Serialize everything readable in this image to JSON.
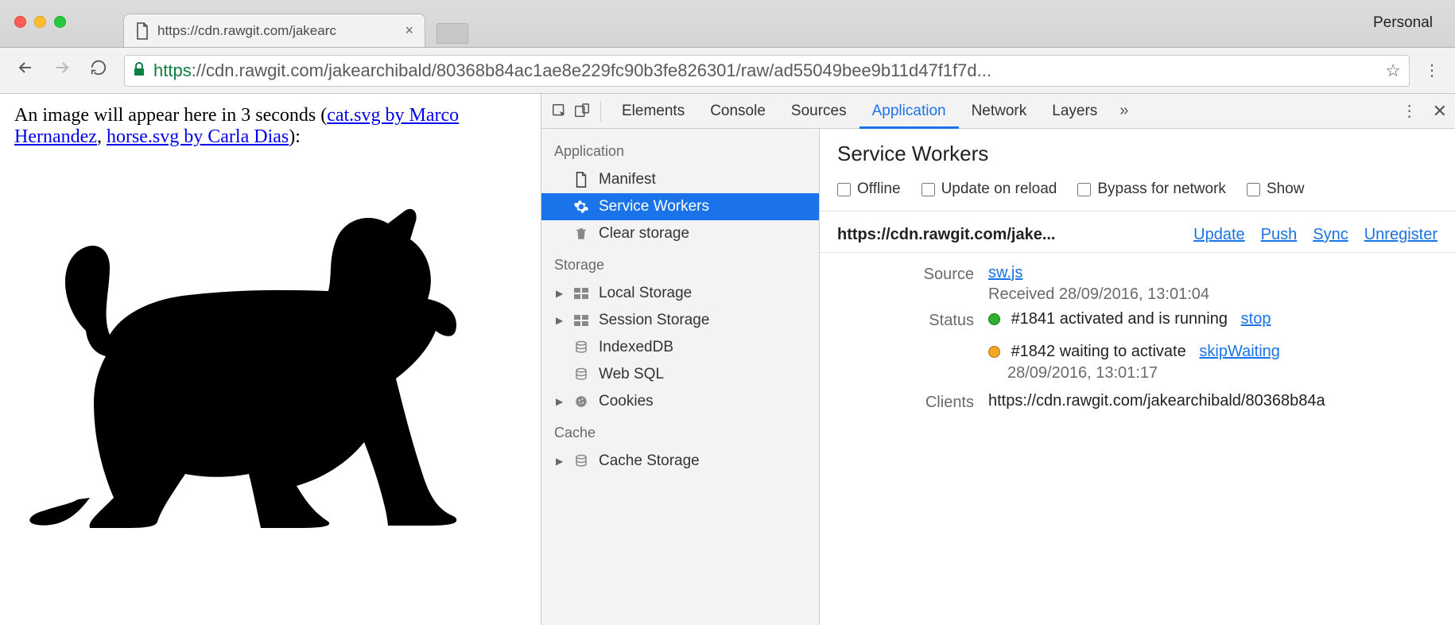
{
  "titlebar": {
    "tab_title": "https://cdn.rawgit.com/jakearc",
    "profile": "Personal"
  },
  "omnibox": {
    "scheme": "https",
    "rest": "://cdn.rawgit.com/jakearchibald/80368b84ac1ae8e229fc90b3fe826301/raw/ad55049bee9b11d47f1f7d..."
  },
  "page": {
    "intro_before": "An image will appear here in 3 seconds (",
    "link1": "cat.svg by Marco Hernandez",
    "sep": ", ",
    "link2": "horse.svg by Carla Dias",
    "intro_after": "):"
  },
  "devtools": {
    "tabs": [
      "Elements",
      "Console",
      "Sources",
      "Application",
      "Network",
      "Layers"
    ],
    "active_tab": "Application",
    "sidebar": {
      "groups": [
        {
          "header": "Application",
          "items": [
            {
              "label": "Manifest",
              "icon": "doc"
            },
            {
              "label": "Service Workers",
              "icon": "gear",
              "selected": true
            },
            {
              "label": "Clear storage",
              "icon": "trash"
            }
          ]
        },
        {
          "header": "Storage",
          "items": [
            {
              "label": "Local Storage",
              "icon": "grid",
              "expandable": true
            },
            {
              "label": "Session Storage",
              "icon": "grid",
              "expandable": true
            },
            {
              "label": "IndexedDB",
              "icon": "db"
            },
            {
              "label": "Web SQL",
              "icon": "db"
            },
            {
              "label": "Cookies",
              "icon": "cookie",
              "expandable": true
            }
          ]
        },
        {
          "header": "Cache",
          "items": [
            {
              "label": "Cache Storage",
              "icon": "db",
              "expandable": true
            }
          ]
        }
      ]
    },
    "service_workers": {
      "title": "Service Workers",
      "checks": [
        "Offline",
        "Update on reload",
        "Bypass for network",
        "Show"
      ],
      "origin": "https://cdn.rawgit.com/jake...",
      "actions": [
        "Update",
        "Push",
        "Sync",
        "Unregister"
      ],
      "source": {
        "label": "Source",
        "link": "sw.js",
        "received": "Received 28/09/2016, 13:01:04"
      },
      "status": {
        "label": "Status",
        "v1": {
          "text": "#1841 activated and is running",
          "action": "stop",
          "color": "green"
        },
        "v2": {
          "text": "#1842 waiting to activate",
          "action": "skipWaiting",
          "sub": "28/09/2016, 13:01:17",
          "color": "orange"
        }
      },
      "clients": {
        "label": "Clients",
        "value": "https://cdn.rawgit.com/jakearchibald/80368b84a"
      }
    }
  }
}
